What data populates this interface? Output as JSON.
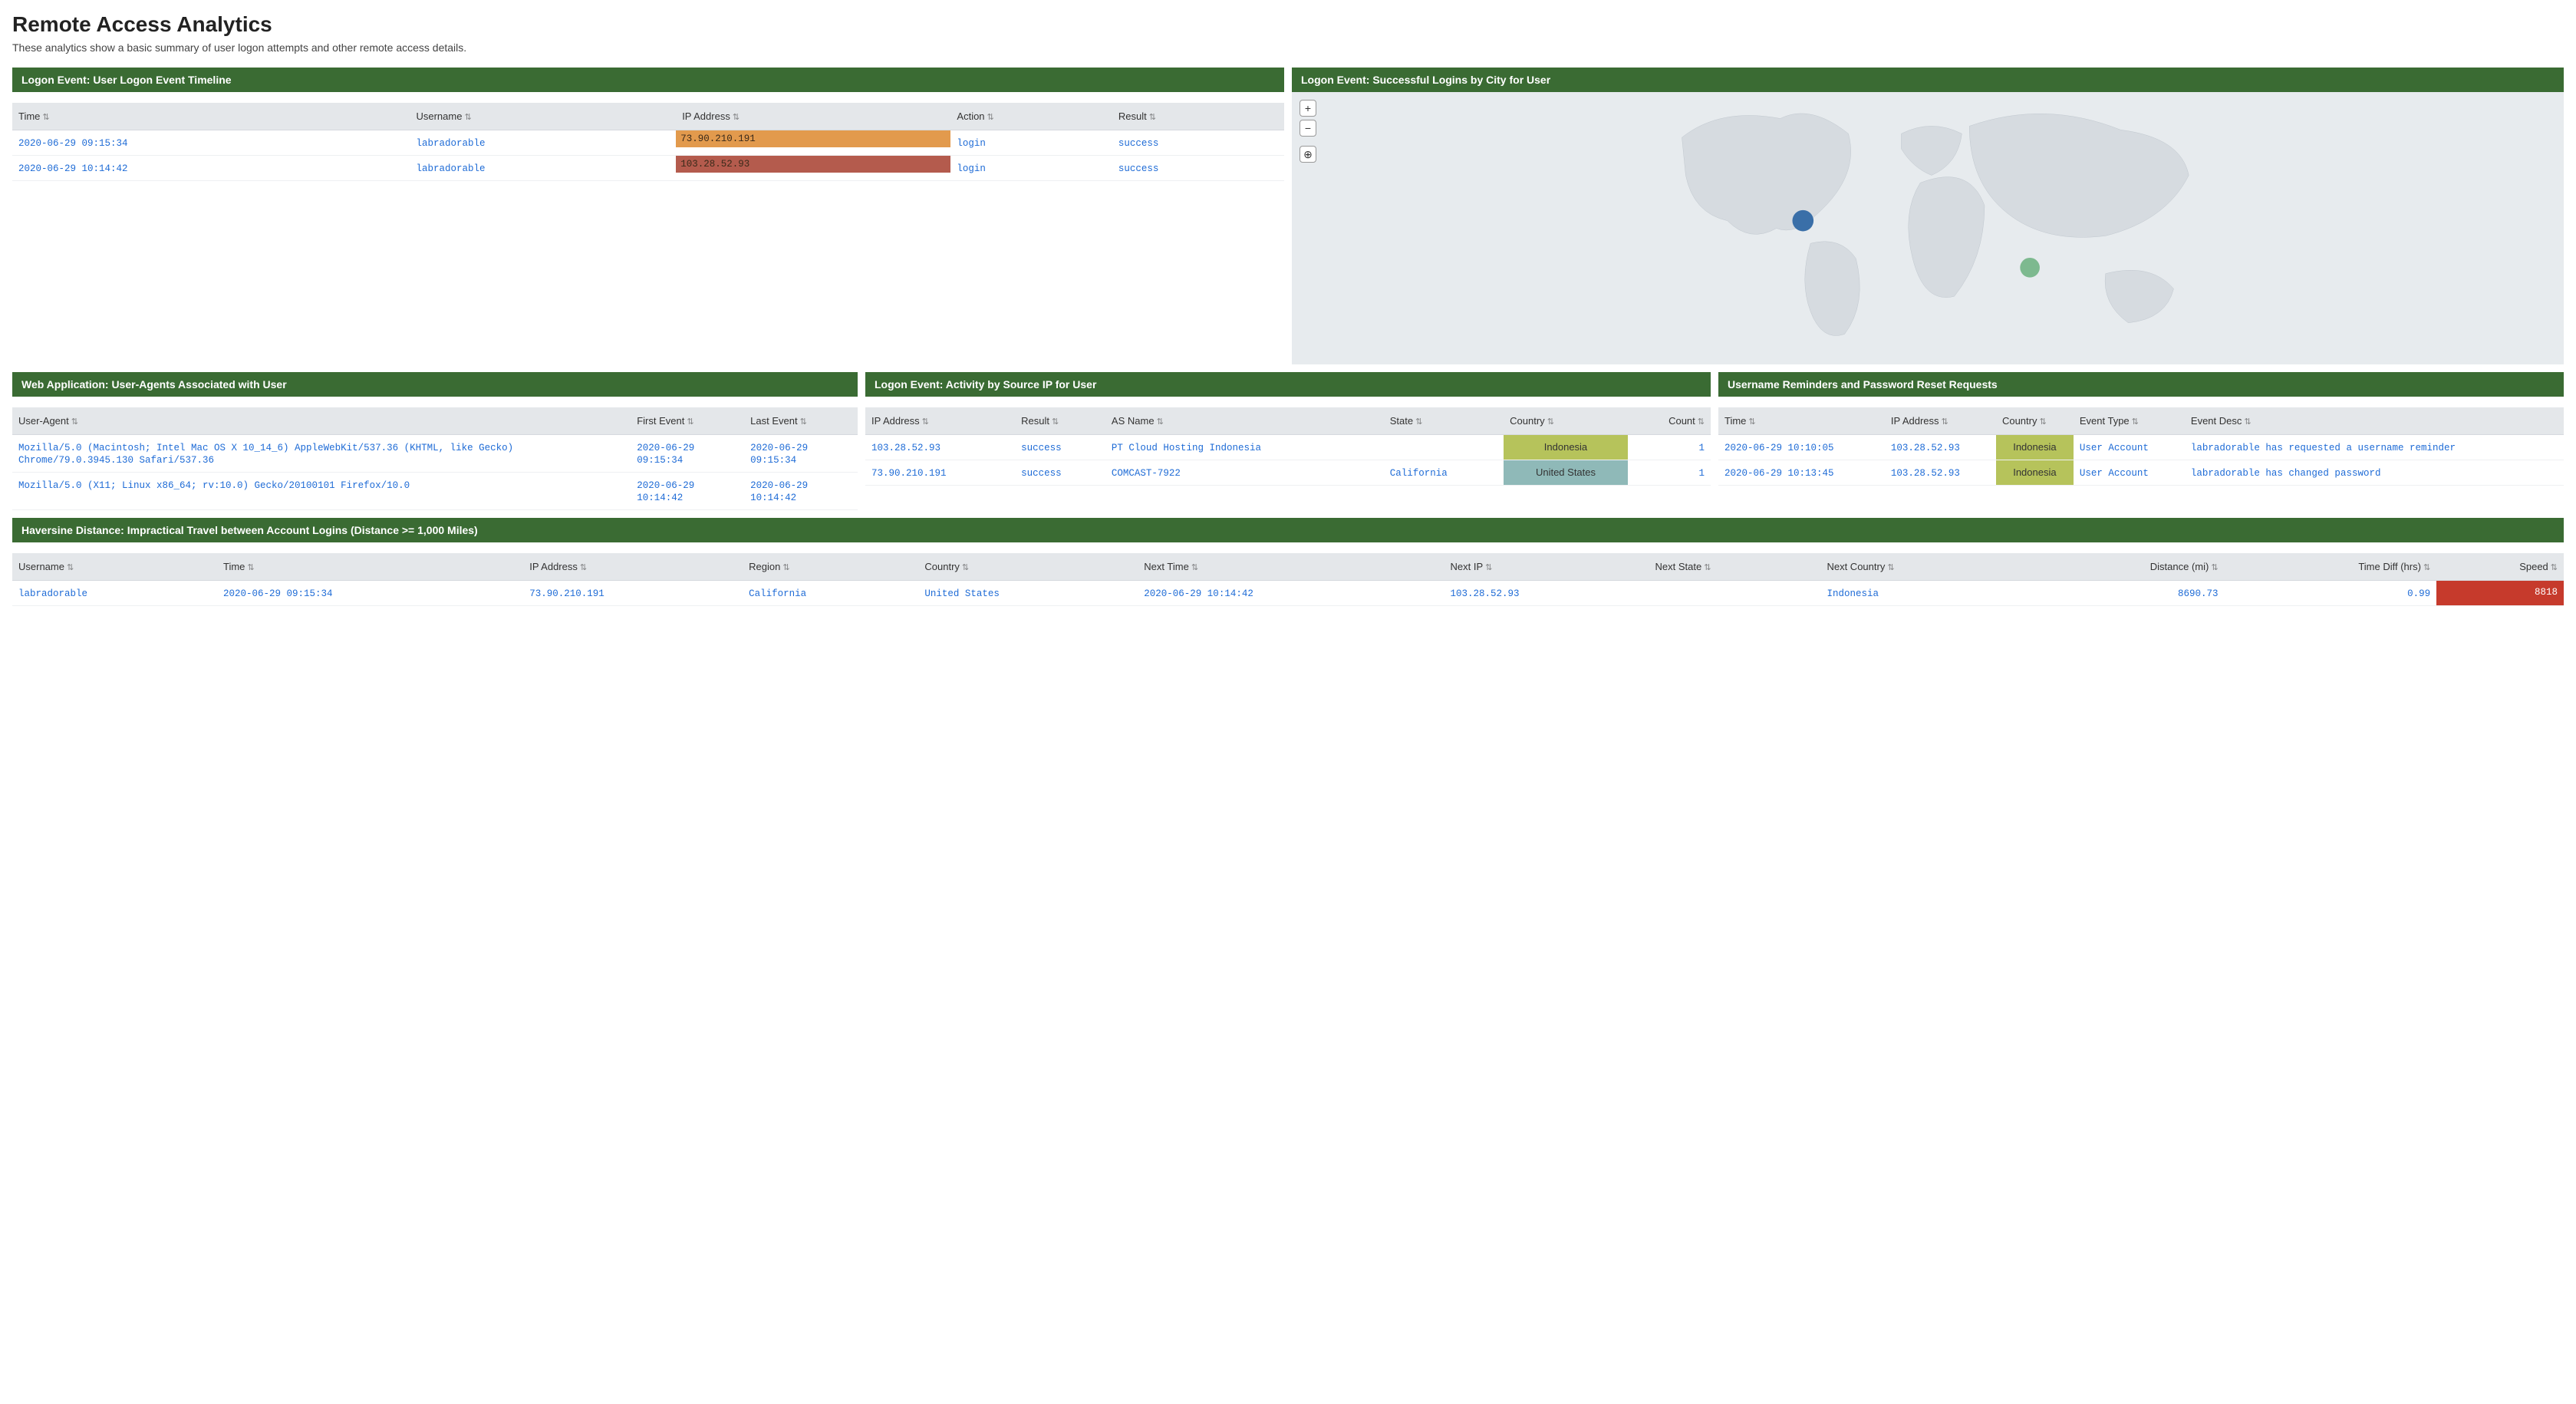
{
  "header": {
    "title": "Remote Access Analytics",
    "subtitle": "These analytics show a basic summary of user logon attempts and other remote access details."
  },
  "panels": {
    "timeline": {
      "title": "Logon Event: User Logon Event Timeline"
    },
    "map": {
      "title": "Logon Event: Successful Logins by City for User"
    },
    "useragents": {
      "title": "Web Application: User-Agents Associated with User"
    },
    "sourceip": {
      "title": "Logon Event: Activity by Source IP for User"
    },
    "reminders": {
      "title": "Username Reminders and Password Reset Requests"
    },
    "haversine": {
      "title": "Haversine Distance: Impractical Travel between Account Logins (Distance >= 1,000 Miles)"
    }
  },
  "timeline": {
    "columns": [
      "Time",
      "Username",
      "IP Address",
      "Action",
      "Result"
    ],
    "rows": [
      {
        "time": "2020-06-29 09:15:34",
        "username": "labradorable",
        "ip": "73.90.210.191",
        "ip_style": "ip-orange",
        "action": "login",
        "result": "success"
      },
      {
        "time": "2020-06-29 10:14:42",
        "username": "labradorable",
        "ip": "103.28.52.93",
        "ip_style": "ip-brown",
        "action": "login",
        "result": "success"
      }
    ]
  },
  "useragents": {
    "columns": [
      "User-Agent",
      "First Event",
      "Last Event"
    ],
    "rows": [
      {
        "ua": "Mozilla/5.0 (Macintosh; Intel Mac OS X 10_14_6) AppleWebKit/537.36 (KHTML, like Gecko) Chrome/79.0.3945.130 Safari/537.36",
        "first": "2020-06-29 09:15:34",
        "last": "2020-06-29 09:15:34"
      },
      {
        "ua": "Mozilla/5.0 (X11; Linux x86_64; rv:10.0) Gecko/20100101 Firefox/10.0",
        "first": "2020-06-29 10:14:42",
        "last": "2020-06-29 10:14:42"
      }
    ]
  },
  "sourceip": {
    "columns": [
      "IP Address",
      "Result",
      "AS Name",
      "State",
      "Country",
      "Count"
    ],
    "rows": [
      {
        "ip": "103.28.52.93",
        "result": "success",
        "asname": "PT Cloud Hosting Indonesia",
        "state": "",
        "country": "Indonesia",
        "country_style": "cell-olive",
        "count": "1"
      },
      {
        "ip": "73.90.210.191",
        "result": "success",
        "asname": "COMCAST-7922",
        "state": "California",
        "country": "United States",
        "country_style": "cell-teal",
        "count": "1"
      }
    ]
  },
  "reminders": {
    "columns": [
      "Time",
      "IP Address",
      "Country",
      "Event Type",
      "Event Desc"
    ],
    "rows": [
      {
        "time": "2020-06-29 10:10:05",
        "ip": "103.28.52.93",
        "country": "Indonesia",
        "country_style": "cell-olive",
        "type": "User Account",
        "desc": "labradorable has requested a username reminder"
      },
      {
        "time": "2020-06-29 10:13:45",
        "ip": "103.28.52.93",
        "country": "Indonesia",
        "country_style": "cell-olive",
        "type": "User Account",
        "desc": "labradorable has changed password"
      }
    ]
  },
  "haversine": {
    "columns": [
      "Username",
      "Time",
      "IP Address",
      "Region",
      "Country",
      "Next Time",
      "Next IP",
      "Next State",
      "Next Country",
      "Distance (mi)",
      "Time Diff (hrs)",
      "Speed"
    ],
    "rows": [
      {
        "username": "labradorable",
        "time": "2020-06-29 09:15:34",
        "ip": "73.90.210.191",
        "region": "California",
        "country": "United States",
        "next_time": "2020-06-29 10:14:42",
        "next_ip": "103.28.52.93",
        "next_state": "",
        "next_country": "Indonesia",
        "distance": "8690.73",
        "timediff": "0.99",
        "speed": "8818"
      }
    ]
  },
  "map_controls": {
    "zoom_in": "+",
    "zoom_out": "−",
    "locate": "⊕"
  }
}
